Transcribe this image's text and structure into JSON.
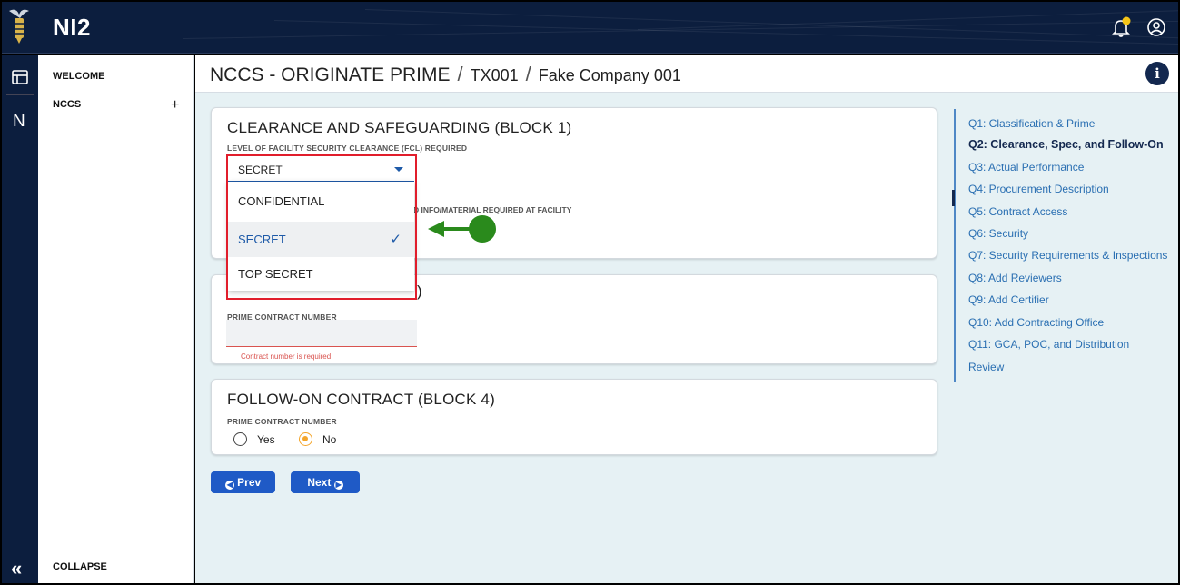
{
  "app": {
    "name": "NI2"
  },
  "rail": {
    "n_label": "N",
    "collapse_glyph": "«"
  },
  "sidenav": {
    "welcome": "WELCOME",
    "nccs": "NCCS",
    "nccs_plus": "+",
    "collapse": "COLLAPSE"
  },
  "header": {
    "title": "NCCS - ORIGINATE PRIME",
    "sep": "/",
    "crumb1": "TX001",
    "crumb2": "Fake Company 001",
    "info": "i"
  },
  "block1": {
    "title": "CLEARANCE AND SAFEGUARDING (BLOCK 1)",
    "fcl_label": "LEVEL OF FACILITY SECURITY CLEARANCE (FCL) REQUIRED",
    "fcl_value": "SECRET",
    "options": [
      "CONFIDENTIAL",
      "SECRET",
      "TOP SECRET"
    ],
    "check": "✓",
    "partial_label": "D INFO/MATERIAL REQUIRED AT FACILITY"
  },
  "block2": {
    "title_tail": ")",
    "label": "PRIME CONTRACT NUMBER",
    "value": "",
    "error": "Contract number is required"
  },
  "block4": {
    "title": "FOLLOW-ON CONTRACT (BLOCK 4)",
    "label": "PRIME CONTRACT NUMBER",
    "yes": "Yes",
    "no": "No",
    "selected": "No"
  },
  "nav": {
    "prev": "Prev",
    "next": "Next"
  },
  "toc": [
    "Q1: Classification & Prime",
    "Q2: Clearance, Spec, and Follow-On",
    "Q3: Actual Performance",
    "Q4: Procurement Description",
    "Q5: Contract Access",
    "Q6: Security",
    "Q7: Security Requirements & Inspections",
    "Q8: Add Reviewers",
    "Q9: Add Certifier",
    "Q10: Add Contracting Office",
    "Q11: GCA, POC, and Distribution",
    "Review"
  ],
  "colors": {
    "navy": "#0c1e3e",
    "accent": "#1f5ac6",
    "error": "#e11d2b",
    "annotation": "#2a8a1c",
    "radio_on": "#f4a52a"
  }
}
